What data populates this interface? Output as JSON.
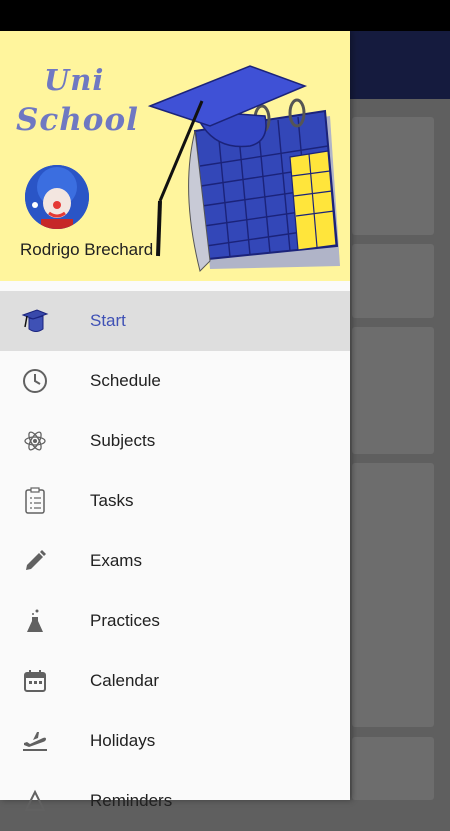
{
  "app": {
    "logo_line1": "Uni",
    "logo_line2": "School"
  },
  "user": {
    "name": "Rodrigo Brechard"
  },
  "menu": {
    "items": [
      {
        "label": "Start",
        "icon": "graduation-cap-icon",
        "active": true
      },
      {
        "label": "Schedule",
        "icon": "clock-icon",
        "active": false
      },
      {
        "label": "Subjects",
        "icon": "atom-icon",
        "active": false
      },
      {
        "label": "Tasks",
        "icon": "clipboard-list-icon",
        "active": false
      },
      {
        "label": "Exams",
        "icon": "pencil-icon",
        "active": false
      },
      {
        "label": "Practices",
        "icon": "flask-icon",
        "active": false
      },
      {
        "label": "Calendar",
        "icon": "calendar-icon",
        "active": false
      },
      {
        "label": "Holidays",
        "icon": "airplane-takeoff-icon",
        "active": false
      },
      {
        "label": "Reminders",
        "icon": "alarm-icon",
        "active": false
      }
    ]
  },
  "colors": {
    "header_bg": "#fff59d",
    "accent": "#3f51b5",
    "toolbar": "#1a237e",
    "logo": "#6f78c2"
  }
}
